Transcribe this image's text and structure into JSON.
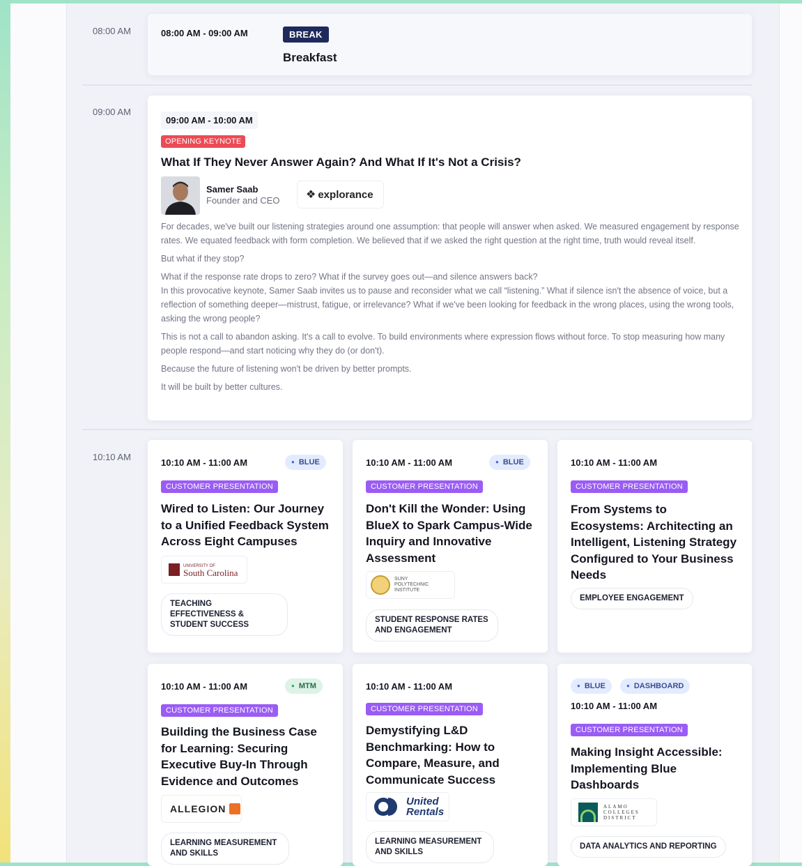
{
  "times": {
    "t1": "08:00 AM",
    "t2": "09:00 AM",
    "t3": "10:10 AM"
  },
  "breakfast": {
    "time": "08:00 AM - 09:00 AM",
    "tag": "BREAK",
    "title": "Breakfast"
  },
  "keynote": {
    "time": "09:00 AM - 10:00 AM",
    "tag": "OPENING KEYNOTE",
    "title": "What If They Never Answer Again? And What If It's Not a Crisis?",
    "speaker_name": "Samer Saab",
    "speaker_role": "Founder and CEO",
    "company": "explorance",
    "paragraphs": [
      "For decades, we've built our listening strategies around one assumption: that people will answer when asked. We measured engagement by response rates. We equated feedback with form completion. We believed that if we asked the right question at the right time, truth would reveal itself.",
      "But what if they stop?",
      "What if the response rate drops to zero? What if the survey goes out—and silence answers back?",
      "In this provocative keynote, Samer Saab invites us to pause and reconsider what we call “listening.” What if silence isn't the absence of voice, but a reflection of something deeper—mistrust, fatigue, or irrelevance? What if we've been looking for feedback in the wrong places, using the wrong tools, asking the wrong people?",
      "This is not a call to abandon asking. It's a call to evolve. To build environments where expression flows without force. To stop measuring how many people respond—and start noticing why they do (or don't).",
      "Because the future of listening won't be driven by better prompts.",
      "It will be built by better cultures."
    ]
  },
  "sessions": [
    {
      "time": "10:10 AM - 11:00 AM",
      "tracks": [
        "BLUE"
      ],
      "tag": "CUSTOMER PRESENTATION",
      "title": "Wired to Listen: Our Journey to a Unified Feedback System Across Eight Campuses",
      "logo_top": "UNIVERSITY OF",
      "logo_name": "South Carolina",
      "topic": "TEACHING EFFECTIVENESS & STUDENT SUCCESS"
    },
    {
      "time": "10:10 AM - 11:00 AM",
      "tracks": [
        "BLUE"
      ],
      "tag": "CUSTOMER PRESENTATION",
      "title": "Don't Kill the Wonder: Using BlueX to Spark Campus-Wide Inquiry and Innovative Assessment",
      "logo_name": "SUNY POLYTECHNIC INSTITUTE",
      "topic": "STUDENT RESPONSE RATES AND ENGAGEMENT"
    },
    {
      "time": "10:10 AM - 11:00 AM",
      "tracks": [],
      "tag": "CUSTOMER PRESENTATION",
      "title": "From Systems to Ecosystems: Architecting an Intelligent, Listening Strategy Configured to Your Business Needs",
      "topic": "EMPLOYEE ENGAGEMENT"
    },
    {
      "time": "10:10 AM - 11:00 AM",
      "tracks": [
        "MTM"
      ],
      "tag": "CUSTOMER PRESENTATION",
      "title": "Building the Business Case for Learning: Securing Executive Buy-In Through Evidence and Outcomes",
      "logo_name": "ALLEGION",
      "topic": "LEARNING MEASUREMENT AND SKILLS"
    },
    {
      "time": "10:10 AM - 11:00 AM",
      "tracks": [],
      "tag": "CUSTOMER PRESENTATION",
      "title": "Demystifying L&D Benchmarking: How to Compare, Measure, and Communicate Success",
      "logo_name": "United Rentals",
      "topic": "LEARNING MEASUREMENT AND SKILLS"
    },
    {
      "time": "10:10 AM - 11:00 AM",
      "tracks": [
        "BLUE",
        "DASHBOARD"
      ],
      "tag": "CUSTOMER PRESENTATION",
      "title": "Making Insight Accessible: Implementing Blue Dashboards",
      "logo_name": "ALAMO COLLEGES DISTRICT",
      "topic": "DATA ANALYTICS AND REPORTING"
    }
  ],
  "colors": {
    "break": "#1e2a5c",
    "keynote": "#ec4b55",
    "customer_presentation": "#9a5cf5",
    "blue_dot": "#3f62e0",
    "mtm_dot": "#2fa565"
  }
}
